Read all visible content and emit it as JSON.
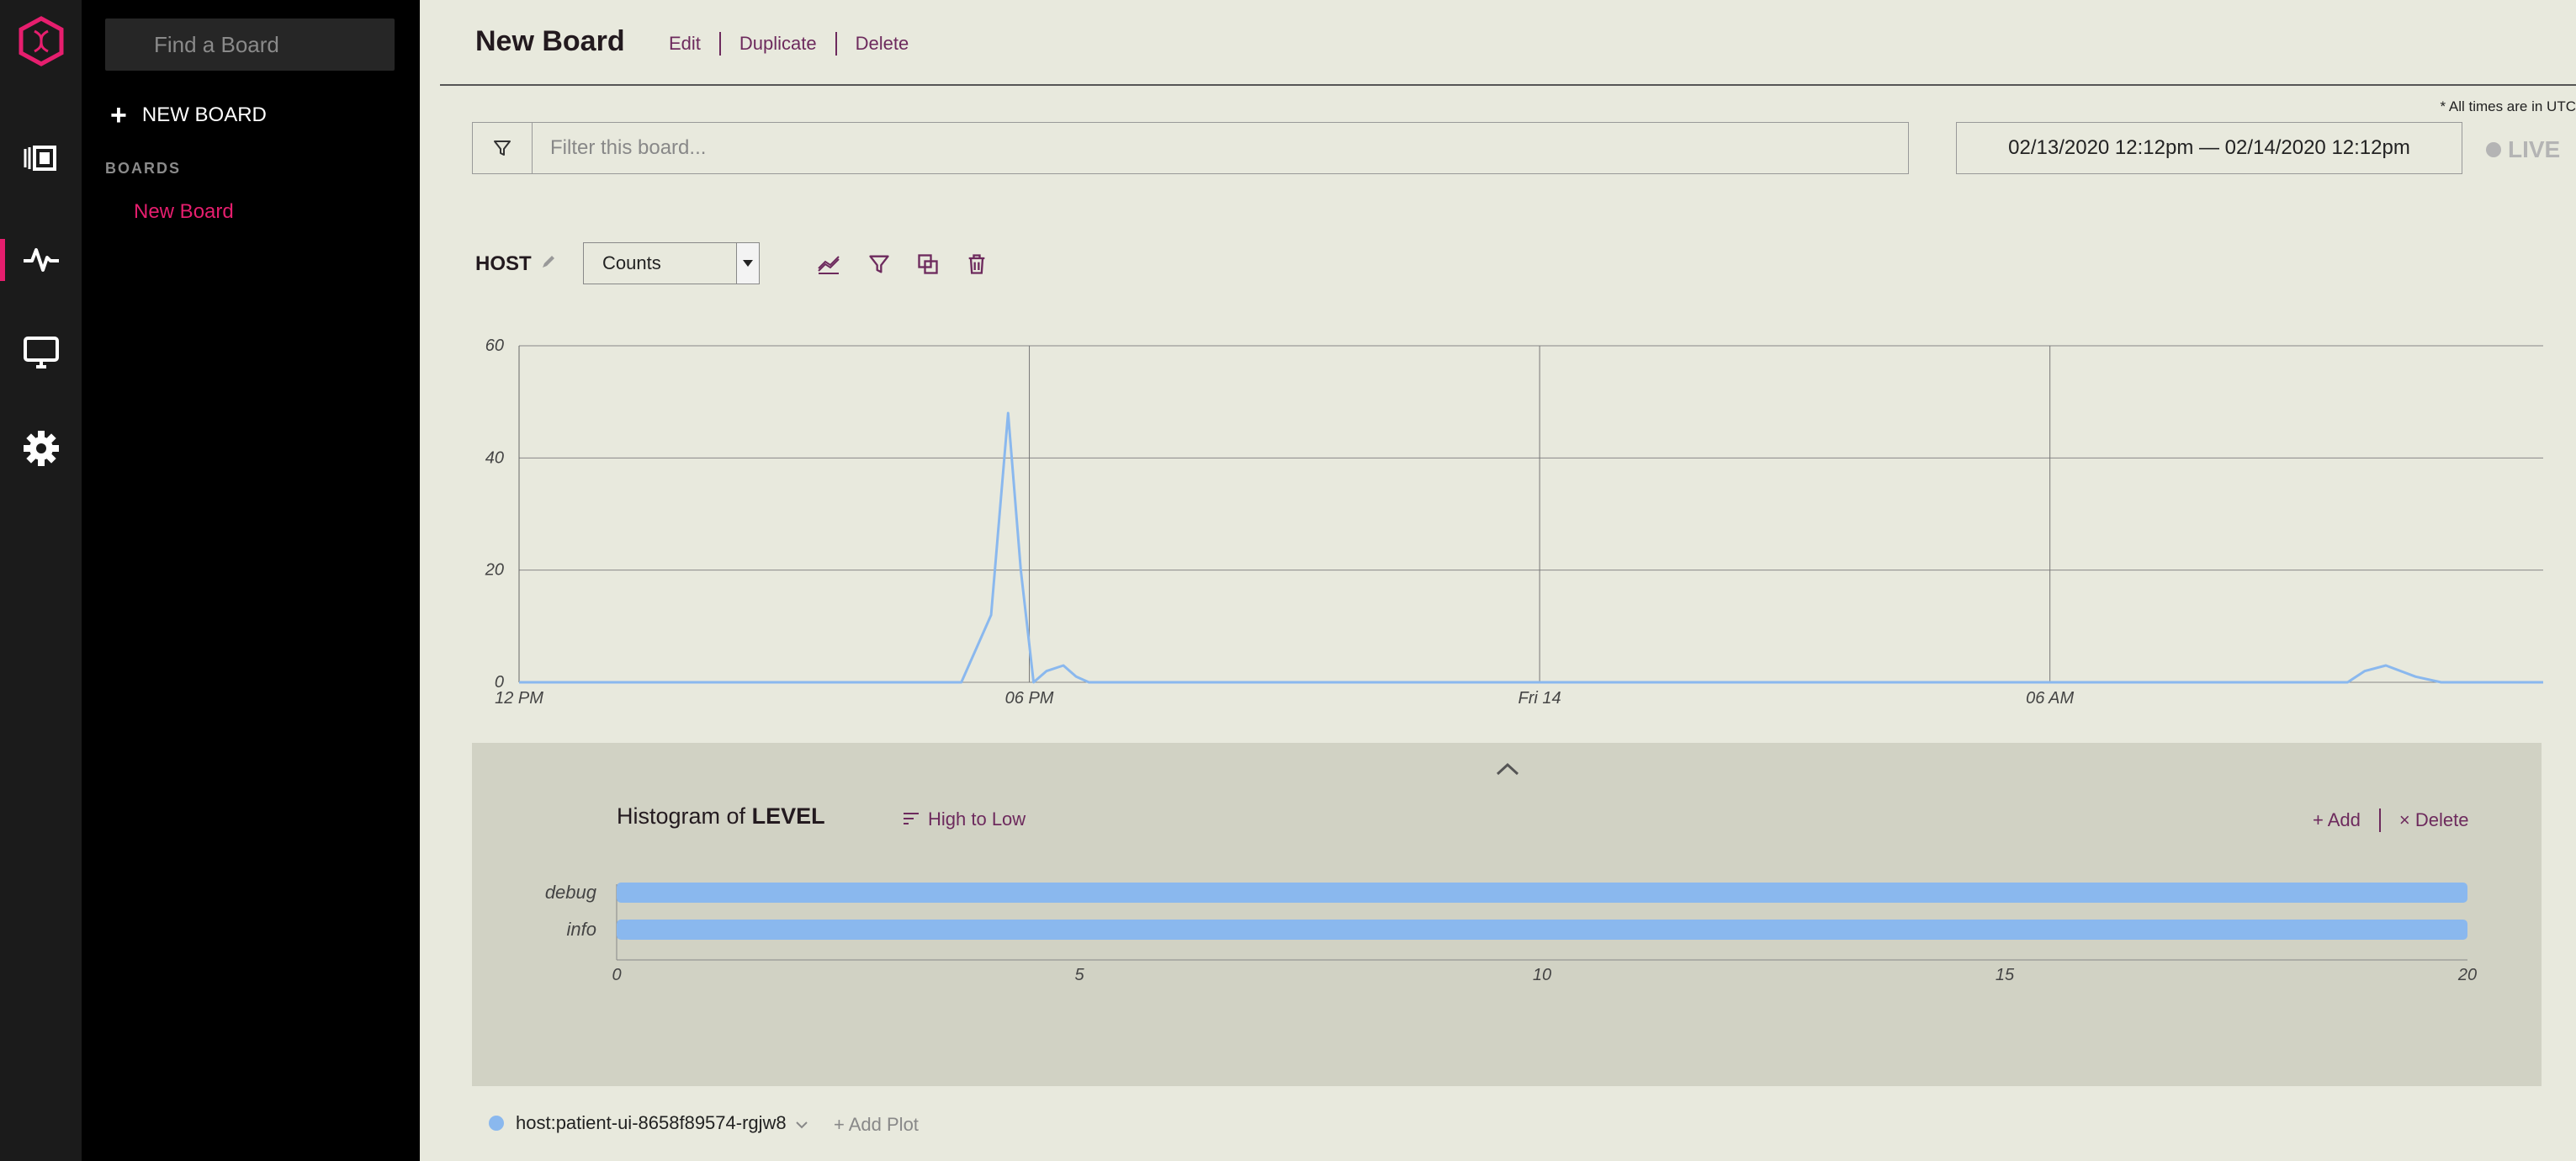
{
  "rail": {
    "icons": [
      "logo-icon",
      "boards-icon",
      "activity-icon",
      "monitor-icon",
      "gear-icon"
    ]
  },
  "sidebar": {
    "search_placeholder": "Find a Board",
    "new_board": "NEW BOARD",
    "boards_heading": "BOARDS",
    "boards": [
      "New Board"
    ]
  },
  "header": {
    "title": "New Board",
    "edit": "Edit",
    "duplicate": "Duplicate",
    "delete": "Delete"
  },
  "utc_note": "* All times are in UTC",
  "filter": {
    "placeholder": "Filter this board..."
  },
  "date_range": "02/13/2020 12:12pm — 02/14/2020 12:12pm",
  "live_label": "LIVE",
  "plot": {
    "group_label": "HOST",
    "metric": "Counts"
  },
  "colors": {
    "accent": "#e61e6e",
    "series": "#8ab8ee",
    "link": "#6d2a5d",
    "background": "#e8e9dd"
  },
  "chart_data": [
    {
      "type": "line",
      "title": "",
      "xlabel": "",
      "ylabel": "",
      "x_ticks": [
        "12 PM",
        "06 PM",
        "Fri 14",
        "06 AM"
      ],
      "y_ticks": [
        "0",
        "20",
        "40",
        "60"
      ],
      "ylim": [
        0,
        60
      ],
      "grid": true,
      "series": [
        {
          "name": "host:patient-ui-8658f89574-rgjw8",
          "x_hours_from_start": [
            0,
            5.2,
            5.55,
            5.75,
            5.9,
            6.05,
            6.2,
            6.4,
            6.55,
            6.7,
            7.1,
            20.5,
            21.5,
            21.7,
            21.95,
            22.3,
            22.6,
            23.8
          ],
          "values": [
            0,
            0,
            12,
            48,
            20,
            0,
            2,
            3,
            1,
            0,
            0,
            0,
            0,
            2,
            3,
            1,
            0,
            0
          ]
        }
      ]
    },
    {
      "type": "bar",
      "orientation": "horizontal",
      "title": "Histogram of LEVEL",
      "categories": [
        "debug",
        "info"
      ],
      "values": [
        20,
        20
      ],
      "x_ticks": [
        "0",
        "5",
        "10",
        "15",
        "20"
      ],
      "xlim": [
        0,
        20
      ]
    }
  ],
  "histogram": {
    "title_prefix": "Histogram of",
    "title_field": "LEVEL",
    "sort_label": "High to Low",
    "add_label": "+ Add",
    "delete_label": "× Delete"
  },
  "footer": {
    "series_label": "host:patient-ui-8658f89574-rgjw8",
    "add_plot": "+ Add Plot"
  }
}
